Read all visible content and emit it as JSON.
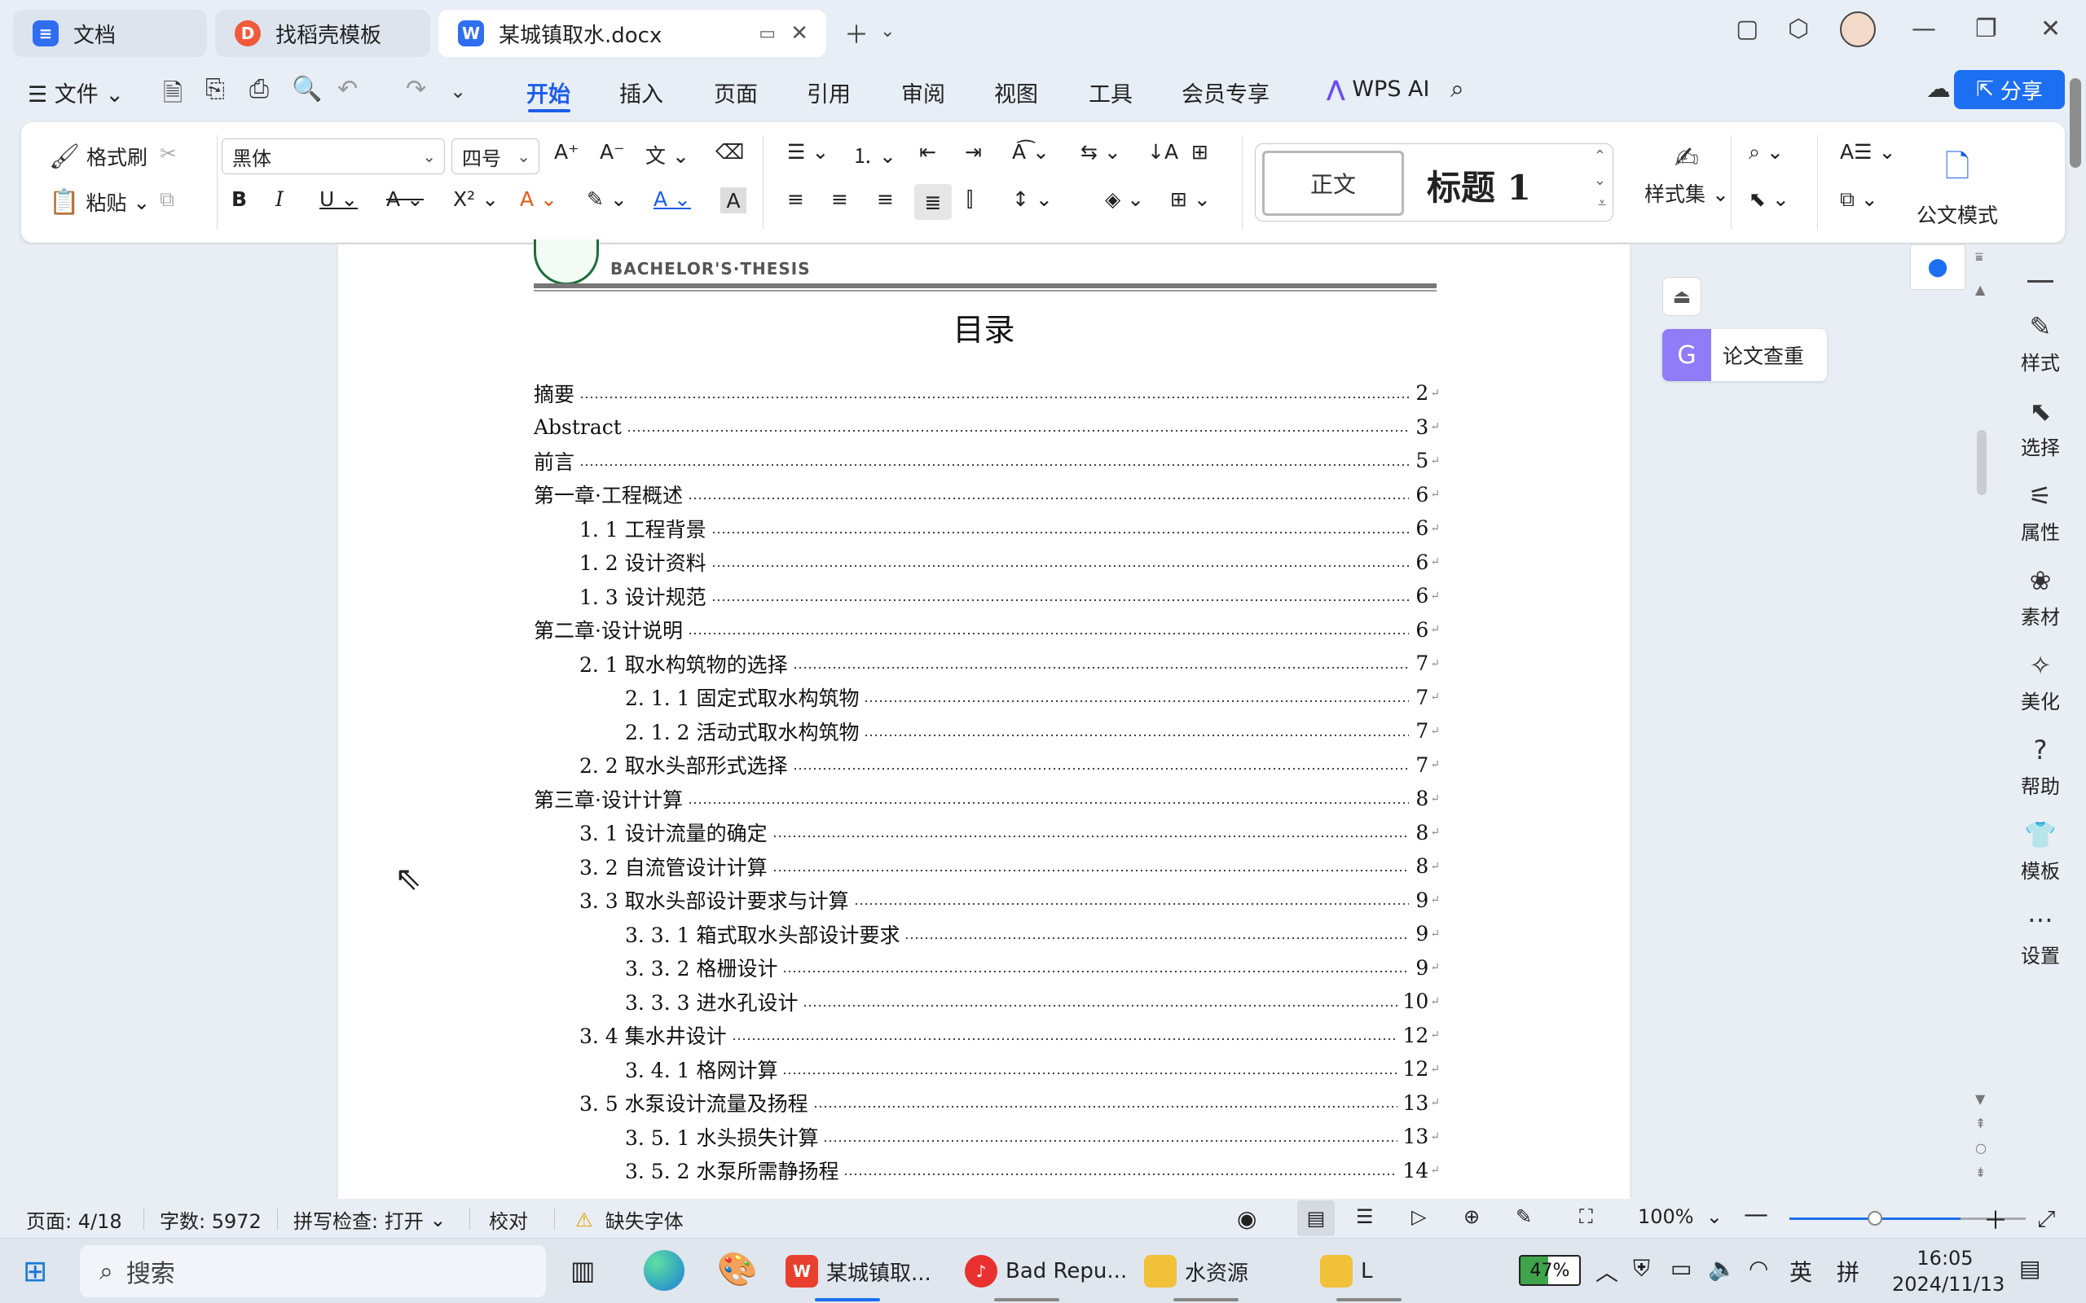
{
  "tabs": [
    {
      "label": "文档",
      "icon": "doc-icon",
      "color": "#2f6ef0"
    },
    {
      "label": "找稻壳模板",
      "icon": "docer-icon",
      "color": "#f05a3c"
    },
    {
      "label": "某城镇取水.docx",
      "icon": "word-icon",
      "color": "#2f6ef0"
    }
  ],
  "menu": {
    "file": "文件",
    "tabs": [
      "开始",
      "插入",
      "页面",
      "引用",
      "审阅",
      "视图",
      "工具",
      "会员专享"
    ],
    "active": "开始",
    "wps_ai": "WPS AI",
    "share": "分享"
  },
  "ribbon": {
    "format_painter": "格式刷",
    "paste": "粘贴",
    "font_name": "黑体",
    "font_size": "四号",
    "style_normal": "正文",
    "style_heading": "标题 1",
    "style_set": "样式集",
    "official_mode": "公文模式"
  },
  "document": {
    "header_text": "BACHELOR'S·THESIS",
    "toc_title": "目录",
    "toc": [
      {
        "label": "摘要",
        "page": "2",
        "level": 1
      },
      {
        "label": "Abstract",
        "page": "3",
        "level": 1
      },
      {
        "label": "前言",
        "page": "5",
        "level": 1
      },
      {
        "label": "第一章·工程概述",
        "page": "6",
        "level": 1
      },
      {
        "label": "1. 1 工程背景",
        "page": "6",
        "level": 2
      },
      {
        "label": "1. 2 设计资料",
        "page": "6",
        "level": 2
      },
      {
        "label": "1. 3 设计规范",
        "page": "6",
        "level": 2
      },
      {
        "label": "第二章·设计说明",
        "page": "6",
        "level": 1
      },
      {
        "label": "2. 1 取水构筑物的选择",
        "page": "7",
        "level": 2
      },
      {
        "label": "2. 1. 1 固定式取水构筑物",
        "page": "7",
        "level": 3
      },
      {
        "label": "2. 1. 2 活动式取水构筑物",
        "page": "7",
        "level": 3
      },
      {
        "label": "2. 2 取水头部形式选择",
        "page": "7",
        "level": 2
      },
      {
        "label": "第三章·设计计算",
        "page": "8",
        "level": 1
      },
      {
        "label": "3. 1 设计流量的确定",
        "page": "8",
        "level": 2
      },
      {
        "label": "3. 2 自流管设计计算",
        "page": "8",
        "level": 2
      },
      {
        "label": "3. 3 取水头部设计要求与计算",
        "page": "9",
        "level": 2
      },
      {
        "label": "3. 3. 1 箱式取水头部设计要求",
        "page": "9",
        "level": 3
      },
      {
        "label": "3. 3. 2 格栅设计",
        "page": "9",
        "level": 3
      },
      {
        "label": "3. 3. 3 进水孔设计",
        "page": "10",
        "level": 3
      },
      {
        "label": "3. 4 集水井设计",
        "page": "12",
        "level": 2
      },
      {
        "label": "3. 4. 1 格网计算",
        "page": "12",
        "level": 3
      },
      {
        "label": "3. 5 水泵设计流量及扬程",
        "page": "13",
        "level": 2
      },
      {
        "label": "3. 5. 1 水头损失计算",
        "page": "13",
        "level": 3
      },
      {
        "label": "3. 5. 2 水泵所需静扬程",
        "page": "14",
        "level": 3
      }
    ]
  },
  "side": {
    "paper_check": "论文查重"
  },
  "right_panel": [
    {
      "label": "样式",
      "icon": "pen-icon"
    },
    {
      "label": "选择",
      "icon": "cursor-icon"
    },
    {
      "label": "属性",
      "icon": "sliders-icon"
    },
    {
      "label": "素材",
      "icon": "image-icon"
    },
    {
      "label": "美化",
      "icon": "magic-icon"
    },
    {
      "label": "帮助",
      "icon": "help-icon"
    },
    {
      "label": "模板",
      "icon": "shirt-icon"
    },
    {
      "label": "设置",
      "icon": "more-icon"
    }
  ],
  "status": {
    "page": "页面: 4/18",
    "words": "字数: 5972",
    "spell": "拼写检查: 打开",
    "proof": "校对",
    "missing_font": "缺失字体",
    "zoom": "100%"
  },
  "taskbar": {
    "search": "搜索",
    "apps": [
      {
        "label": "某城镇取...",
        "icon": "wps-icon",
        "color": "#e8402f"
      },
      {
        "label": "Bad Repu...",
        "icon": "netease-music-icon",
        "color": "#e8302f"
      },
      {
        "label": "水资源",
        "icon": "folder-icon",
        "color": "#f2c13a"
      },
      {
        "label": "L",
        "icon": "folder-icon",
        "color": "#f2c13a"
      }
    ],
    "battery": "47%",
    "ime_lang": "英",
    "ime_mode": "拼",
    "time": "16:05",
    "date": "2024/11/13"
  }
}
